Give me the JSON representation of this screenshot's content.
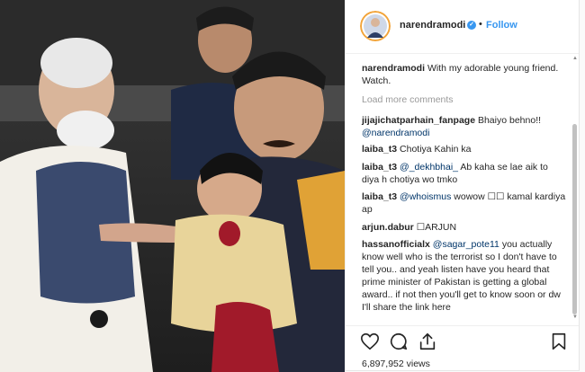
{
  "post": {
    "username": "narendramodi",
    "separator": "•",
    "follow_label": "Follow",
    "verified_icon": "verified-badge-icon"
  },
  "caption": {
    "username": "narendramodi",
    "text": "With my adorable young friend. Watch."
  },
  "load_more_label": "Load more comments",
  "comments": [
    {
      "username": "jijajichatparhain_fanpage",
      "text": "Bhaiyo behno!!",
      "mention": "@narendramodi",
      "after": ""
    },
    {
      "username": "laiba_t3",
      "text": "Chotiya Kahin ka",
      "mention": "",
      "after": ""
    },
    {
      "username": "laiba_t3",
      "text": "",
      "mention": "@_dekhbhai_",
      "after": "Ab kaha se lae aik to diya h chotiya wo tmko"
    },
    {
      "username": "laiba_t3",
      "text": "",
      "mention": "@whoismus",
      "after": "wowow ☐☐ kamal kardiya ap"
    },
    {
      "username": "arjun.dabur",
      "text": "☐ARJUN",
      "mention": "",
      "after": ""
    },
    {
      "username": "hassanofficialx",
      "text": "",
      "mention": "@sagar_pote11",
      "after": "you actually know well who is the terrorist so I don't have to tell you.. and yeah listen have you heard that prime minister of Pakistan is getting a global award.. if not then you'll get to know soon or dw I'll share the link here"
    }
  ],
  "actions": {
    "like_icon": "heart-icon",
    "comment_icon": "comment-icon",
    "share_icon": "share-icon",
    "save_icon": "bookmark-icon"
  },
  "views": "6,897,952 views",
  "colors": {
    "link": "#3897f0",
    "mention": "#003569",
    "muted": "#999999",
    "text": "#262626"
  }
}
